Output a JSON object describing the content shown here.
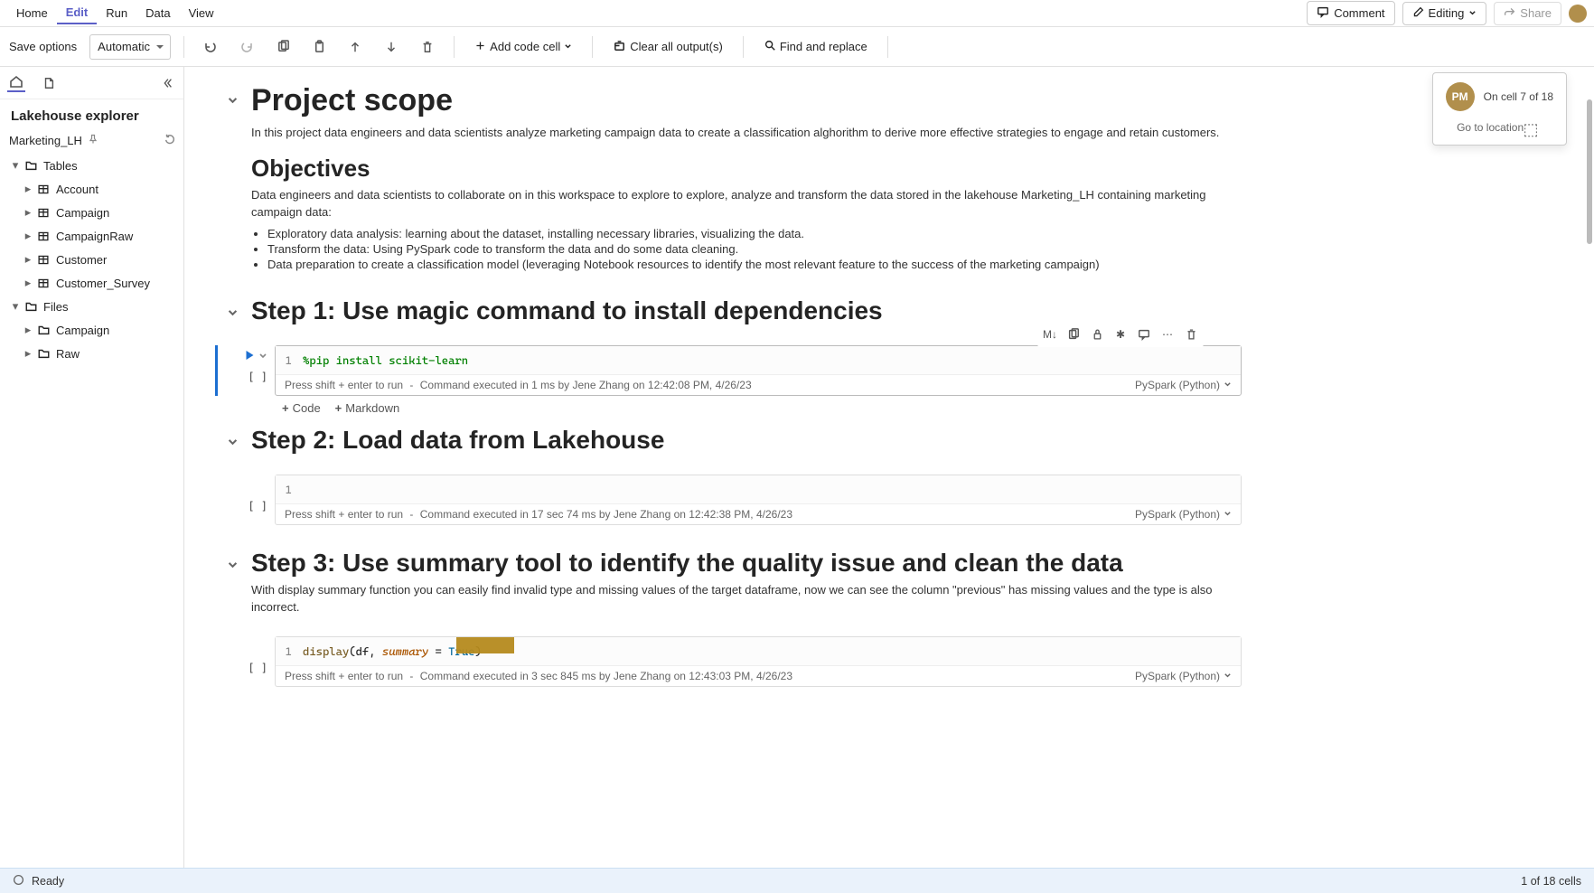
{
  "menu": {
    "items": [
      "Home",
      "Edit",
      "Run",
      "Data",
      "View"
    ],
    "active_index": 1,
    "comment": "Comment",
    "editing": "Editing",
    "share": "Share"
  },
  "toolbar": {
    "save_options_label": "Save options",
    "save_options_value": "Automatic",
    "add_code_cell": "Add code cell",
    "clear_outputs": "Clear all output(s)",
    "find_replace": "Find and replace"
  },
  "sidebar": {
    "title": "Lakehouse explorer",
    "lakehouse_name": "Marketing_LH",
    "tree": {
      "tables_label": "Tables",
      "tables": [
        "Account",
        "Campaign",
        "CampaignRaw",
        "Customer",
        "Customer_Survey"
      ],
      "files_label": "Files",
      "files": [
        "Campaign",
        "Raw"
      ]
    }
  },
  "collab": {
    "initials": "PM",
    "cell_status": "On cell 7 of 18",
    "go_to": "Go to location"
  },
  "notebook": {
    "section0": {
      "h1": "Project scope",
      "p1": "In this project data engineers and data scientists analyze marketing campaign data to create a classification alghorithm to derive more effective strategies to engage and retain customers.",
      "h2": "Objectives",
      "p2": "Data engineers and data scientists to collaborate on in this workspace to explore to explore, analyze and transform the data stored in the lakehouse Marketing_LH containing marketing campaign data:",
      "bullets": [
        "Exploratory data analysis: learning about the dataset, installing necessary libraries, visualizing the data.",
        "Transform the data: Using PySpark code to transform the data and do some data cleaning.",
        "Data preparation to create a classification model (leveraging Notebook resources to identify the most relevant feature to the success of the marketing campaign)"
      ]
    },
    "step1": {
      "heading": "Step 1: Use magic command to install dependencies",
      "code_lineno": "1",
      "code": "%pip install scikit-learn",
      "status_l": "Press shift + enter to run",
      "status_r": "Command executed in 1 ms by Jene Zhang on 12:42:08 PM, 4/26/23",
      "lang": "PySpark (Python)",
      "toolbar_md": "M↓"
    },
    "add": {
      "code": "Code",
      "markdown": "Markdown"
    },
    "step2": {
      "heading": "Step 2: Load data from Lakehouse",
      "code_lineno": "1",
      "code": "",
      "status_l": "Press shift + enter to run",
      "status_r": "Command executed in 17 sec 74 ms by Jene Zhang on 12:42:38 PM, 4/26/23",
      "lang": "PySpark (Python)"
    },
    "step3": {
      "heading": "Step 3: Use summary tool to identify the quality issue and clean the data",
      "p": "With display summary function you can easily find invalid type and missing values of the target dataframe, now we can see the column \"previous\" has missing values and the type is also incorrect.",
      "code_lineno": "1",
      "code_fn": "display",
      "code_rest1": "(df, ",
      "code_arg": "summary",
      "code_rest2": " = ",
      "code_bool": "True",
      "code_rest3": ")",
      "status_l": "Press shift + enter to run",
      "status_r": "Command executed in 3 sec 845 ms by Jene Zhang on 12:43:03 PM, 4/26/23",
      "lang": "PySpark (Python)"
    }
  },
  "statusbar": {
    "ready": "Ready",
    "cells": "1 of 18 cells"
  }
}
